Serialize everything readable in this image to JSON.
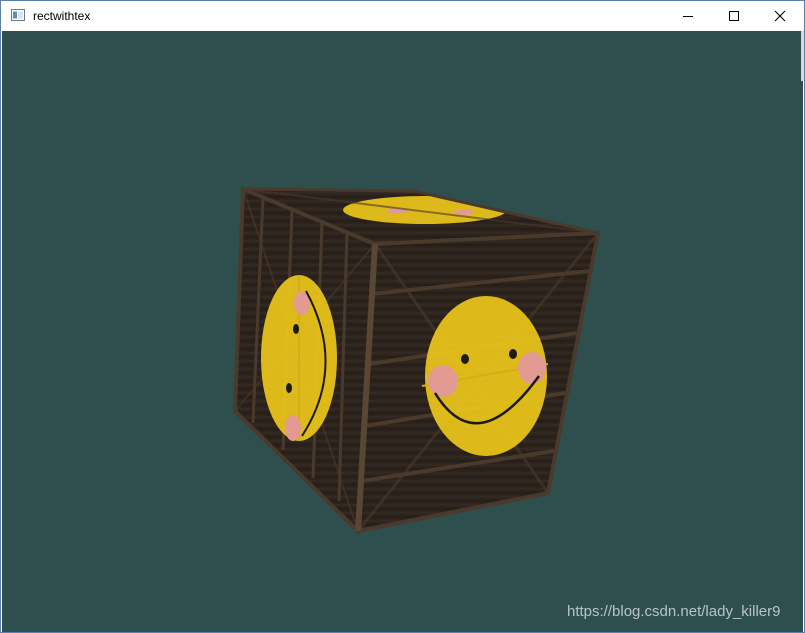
{
  "window": {
    "title": "rectwithtex"
  },
  "controls": [
    {
      "name": "minimize-button",
      "icon": "minimize-icon"
    },
    {
      "name": "maximize-button",
      "icon": "maximize-icon"
    },
    {
      "name": "close-button",
      "icon": "close-icon"
    }
  ],
  "viewport": {
    "background": "#2f4f4f"
  },
  "scene": {
    "object": "textured-cube",
    "texture_colors": {
      "wood": "#2c241d",
      "frame": "#4a3a2c",
      "smiley": "#e7c21a",
      "cheek": "#e39a92",
      "feature": "#1d1a15"
    }
  },
  "watermark": {
    "text": "https://blog.csdn.net/lady_killer9"
  }
}
